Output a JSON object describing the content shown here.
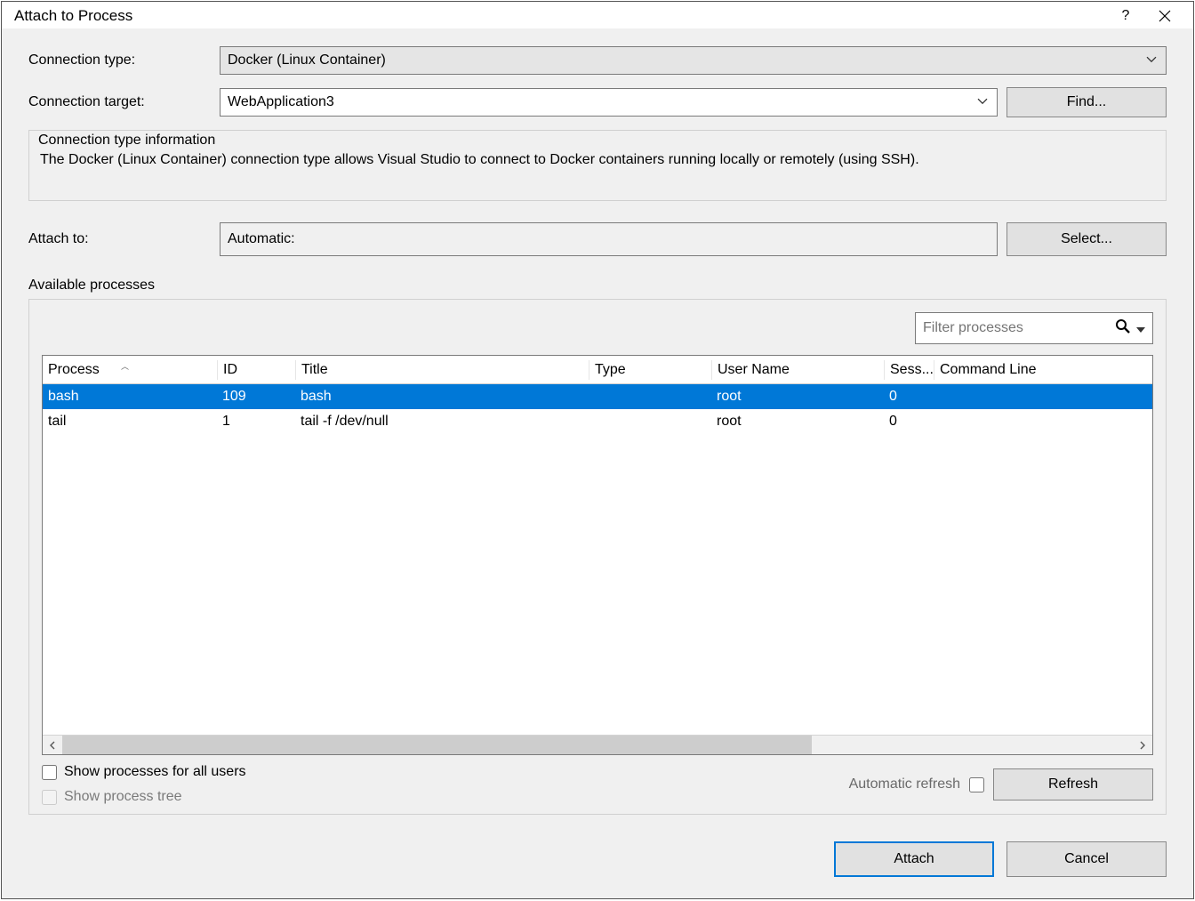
{
  "window": {
    "title": "Attach to Process"
  },
  "connection": {
    "type_label": "Connection type:",
    "type_value": "Docker (Linux Container)",
    "target_label": "Connection target:",
    "target_value": "WebApplication3",
    "find_button": "Find...",
    "info_legend": "Connection type information",
    "info_text": "The Docker (Linux Container) connection type allows Visual Studio to connect to Docker containers running locally or remotely (using SSH)."
  },
  "attach": {
    "label": "Attach to:",
    "value": "Automatic:",
    "select_button": "Select..."
  },
  "processes": {
    "legend": "Available processes",
    "filter_placeholder": "Filter processes",
    "columns": {
      "process": "Process",
      "id": "ID",
      "title": "Title",
      "type": "Type",
      "user": "User Name",
      "session": "Sess...",
      "cmd": "Command Line"
    },
    "rows": [
      {
        "process": "bash",
        "id": "109",
        "title": "bash",
        "type": "",
        "user": "root",
        "session": "0",
        "cmd": "",
        "selected": true
      },
      {
        "process": "tail",
        "id": "1",
        "title": "tail -f /dev/null",
        "type": "",
        "user": "root",
        "session": "0",
        "cmd": "",
        "selected": false
      }
    ],
    "show_all_users": "Show processes for all users",
    "show_tree": "Show process tree",
    "auto_refresh": "Automatic refresh",
    "refresh_button": "Refresh"
  },
  "footer": {
    "attach": "Attach",
    "cancel": "Cancel"
  }
}
